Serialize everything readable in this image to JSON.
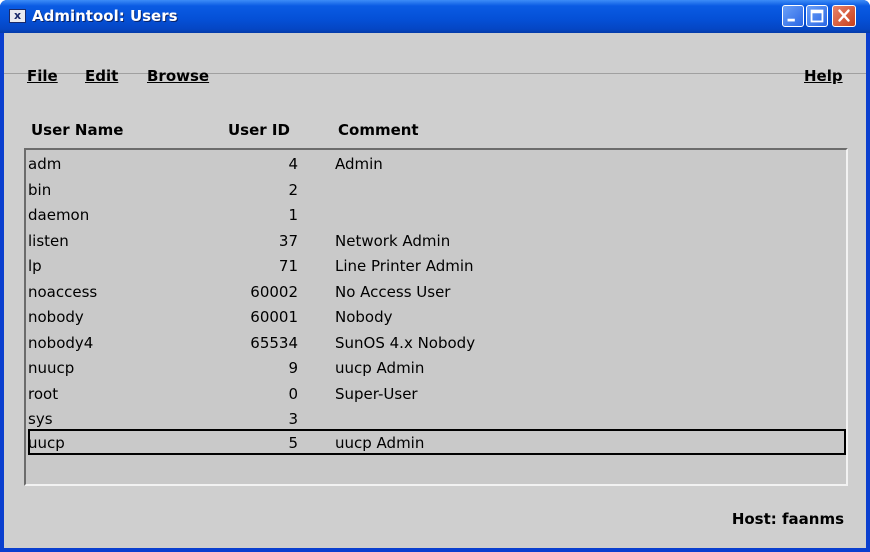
{
  "window": {
    "title": "Admintool: Users",
    "icon": "admintool-app-icon",
    "controls": [
      "minimize-icon",
      "maximize-icon",
      "close-icon"
    ]
  },
  "menubar": {
    "file": "File",
    "edit": "Edit",
    "browse": "Browse",
    "help": "Help"
  },
  "table": {
    "columns": {
      "user_name": "User Name",
      "user_id": "User ID",
      "comment": "Comment"
    },
    "rows": [
      {
        "name": "adm",
        "id": "4",
        "comment": "Admin"
      },
      {
        "name": "bin",
        "id": "2",
        "comment": ""
      },
      {
        "name": "daemon",
        "id": "1",
        "comment": ""
      },
      {
        "name": "listen",
        "id": "37",
        "comment": "Network Admin"
      },
      {
        "name": "lp",
        "id": "71",
        "comment": "Line Printer Admin"
      },
      {
        "name": "noaccess",
        "id": "60002",
        "comment": "No Access User"
      },
      {
        "name": "nobody",
        "id": "60001",
        "comment": "Nobody"
      },
      {
        "name": "nobody4",
        "id": "65534",
        "comment": "SunOS 4.x Nobody"
      },
      {
        "name": "nuucp",
        "id": "9",
        "comment": "uucp Admin"
      },
      {
        "name": "root",
        "id": "0",
        "comment": "Super-User"
      },
      {
        "name": "sys",
        "id": "3",
        "comment": ""
      },
      {
        "name": "uucp",
        "id": "5",
        "comment": "uucp Admin"
      }
    ],
    "selected_row": "uucp"
  },
  "status": {
    "host": "Host: faanms"
  }
}
